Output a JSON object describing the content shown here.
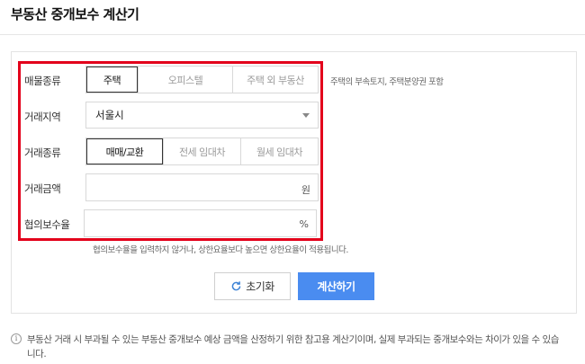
{
  "page": {
    "title": "부동산 중개보수 계산기"
  },
  "form": {
    "property_type": {
      "label": "매물종류",
      "options": [
        "주택",
        "오피스텔",
        "주택 외 부동산"
      ],
      "selected": "주택",
      "note": "주택의 부속토지, 주택분양권 포함"
    },
    "region": {
      "label": "거래지역",
      "value": "서울시"
    },
    "deal_type": {
      "label": "거래종류",
      "options": [
        "매매/교환",
        "전세 임대차",
        "월세 임대차"
      ],
      "selected": "매매/교환"
    },
    "amount": {
      "label": "거래금액",
      "value": "",
      "unit": "원"
    },
    "rate": {
      "label": "협의보수율",
      "value": "",
      "unit": "%",
      "hint": "협의보수율을 입력하지 않거나, 상한요율보다 높으면 상한요율이 적용됩니다."
    }
  },
  "buttons": {
    "reset_label": "초기화",
    "calc_label": "계산하기"
  },
  "footer": {
    "icon": "info-icon",
    "text": "부동산 거래 시 부과될 수 있는 부동산 중개보수 예상 금액을 산정하기 위한 참고용 계산기이며, 실제 부과되는 중개보수와는 차이가 있을 수 있습니다."
  },
  "colors": {
    "highlight": "#e3001b",
    "primary_button": "#4a8cf0"
  }
}
